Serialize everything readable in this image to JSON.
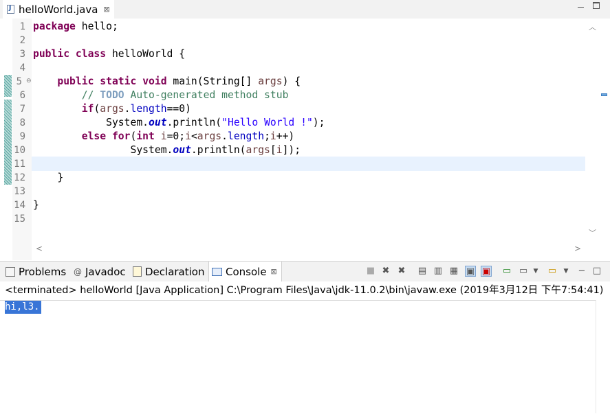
{
  "editor": {
    "tab_title": "helloWorld.java",
    "close_glyph": "⊠",
    "line_numbers": [
      "1",
      "2",
      "3",
      "4",
      "5",
      "6",
      "7",
      "8",
      "9",
      "10",
      "11",
      "12",
      "13",
      "14",
      "15"
    ],
    "fold_marker": "⊖",
    "code": {
      "l1": {
        "kw": "package",
        "rest": " hello;"
      },
      "l3": {
        "kw1": "public",
        "kw2": "class",
        "rest": " helloWorld {"
      },
      "l5": {
        "kw1": "public",
        "kw2": "static",
        "kw3": "void",
        "rest1": " main(String[] ",
        "var": "args",
        "rest2": ") {"
      },
      "l6": {
        "slashes": "// ",
        "todo": "TODO",
        "comment": " Auto-generated method stub"
      },
      "l7": {
        "kw": "if",
        "open": "(",
        "var": "args",
        "dot": ".",
        "field": "length",
        "rest": "==0)"
      },
      "l8": {
        "pre": "System.",
        "field": "out",
        "mid": ".println(",
        "str": "\"Hello World !\"",
        "end": ");"
      },
      "l9": {
        "kw1": "else",
        "kw2": "for",
        "open": "(",
        "kw3": "int",
        "a": " ",
        "var1": "i",
        "b": "=0;",
        "var2": "i",
        "c": "<",
        "var3": "args",
        "dot": ".",
        "field": "length",
        "d": ";",
        "var4": "i",
        "e": "++)"
      },
      "l10": {
        "pre": "System.",
        "field": "out",
        "mid": ".println(",
        "var1": "args",
        "b": "[",
        "var2": "i",
        "c": "]);"
      },
      "l12": {
        "text": "}"
      },
      "l14": {
        "text": "}"
      }
    }
  },
  "panel": {
    "tabs": [
      {
        "label": "Problems",
        "icon": "problems-icon"
      },
      {
        "label": "Javadoc",
        "icon": "javadoc-icon"
      },
      {
        "label": "Declaration",
        "icon": "declaration-icon"
      },
      {
        "label": "Console",
        "icon": "console-icon"
      }
    ],
    "close_glyph": "⊠",
    "status": "<terminated> helloWorld [Java Application] C:\\Program Files\\Java\\jdk-11.0.2\\bin\\javaw.exe (2019年3月12日 下午7:54:41)",
    "output": "hi,l3."
  },
  "colors": {
    "keyword": "#7f0055",
    "comment": "#3f7f5f",
    "string": "#2a00ff",
    "field": "#0000c0",
    "current_line": "#e8f2fe",
    "selection": "#3875d7"
  }
}
